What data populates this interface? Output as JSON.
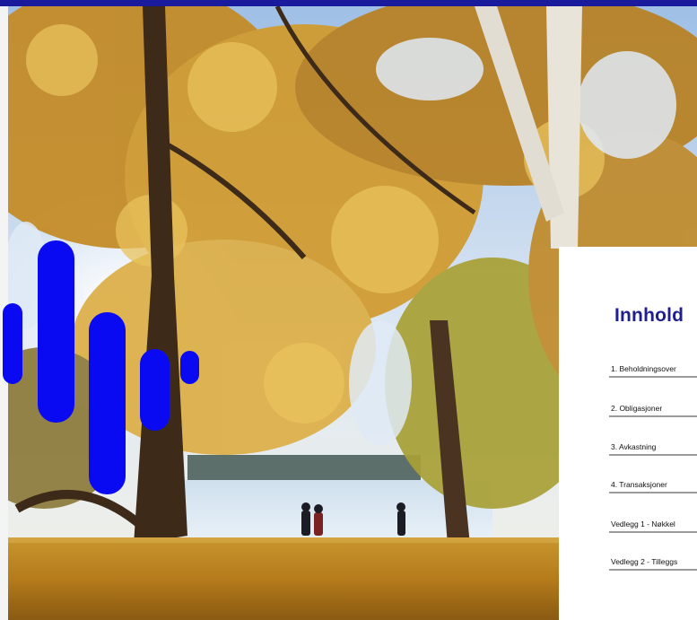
{
  "document": {
    "toc_title": "Innhold",
    "toc_items": [
      "1. Beholdningsover",
      "2. Obligasjoner",
      "3. Avkastning",
      "4. Transaksjoner",
      "Vedlegg 1 - Nøkkel",
      "Vedlegg 2 - Tilleggs"
    ]
  },
  "colors": {
    "brand_blue": "#0a0af2",
    "title_blue": "#1f1f8f",
    "top_bar": "#1a1a9c"
  }
}
